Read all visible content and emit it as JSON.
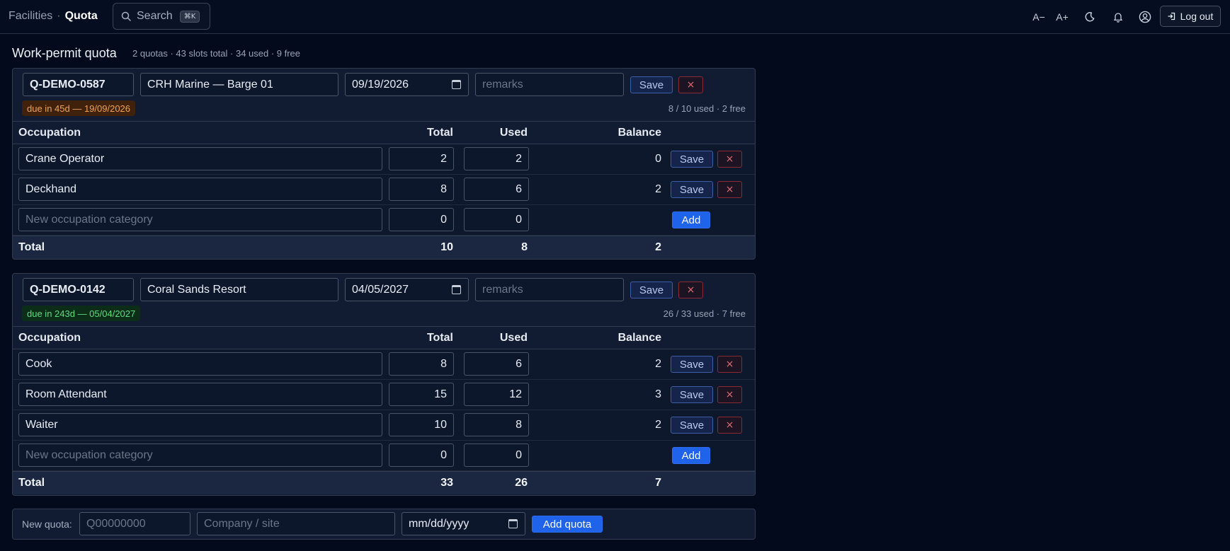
{
  "nav": {
    "breadcrumb_parent": "Facilities",
    "breadcrumb_separator": "·",
    "breadcrumb_current": "Quota",
    "search_label": "Search",
    "search_shortcut": "⌘K",
    "font_decrease": "A−",
    "font_increase": "A+",
    "logout_label": "Log out"
  },
  "page": {
    "title": "Work-permit quota",
    "summary": "2 quotas · 43 slots total · 34 used · 9 free"
  },
  "table_headers": {
    "occupation": "Occupation",
    "total": "Total",
    "used": "Used",
    "balance": "Balance"
  },
  "labels": {
    "save": "Save",
    "delete": "×",
    "add": "Add",
    "total_row": "Total",
    "remarks_placeholder": "remarks",
    "new_occupation_placeholder": "New occupation category"
  },
  "quotas": [
    {
      "code": "Q-DEMO-0587",
      "company": "CRH Marine — Barge 01",
      "date": "09/19/2026",
      "due_label": "due in 45d — 19/09/2026",
      "due_status": "warning",
      "usage": "8 / 10 used · 2 free",
      "rows": [
        {
          "occupation": "Crane Operator",
          "total": "2",
          "used": "2",
          "balance": "0"
        },
        {
          "occupation": "Deckhand",
          "total": "8",
          "used": "6",
          "balance": "2"
        }
      ],
      "new_row": {
        "total": "0",
        "used": "0"
      },
      "totals": {
        "total": "10",
        "used": "8",
        "balance": "2"
      }
    },
    {
      "code": "Q-DEMO-0142",
      "company": "Coral Sands Resort",
      "date": "04/05/2027",
      "due_label": "due in 243d — 05/04/2027",
      "due_status": "ok",
      "usage": "26 / 33 used · 7 free",
      "rows": [
        {
          "occupation": "Cook",
          "total": "8",
          "used": "6",
          "balance": "2"
        },
        {
          "occupation": "Room Attendant",
          "total": "15",
          "used": "12",
          "balance": "3"
        },
        {
          "occupation": "Waiter",
          "total": "10",
          "used": "8",
          "balance": "2"
        }
      ],
      "new_row": {
        "total": "0",
        "used": "0"
      },
      "totals": {
        "total": "33",
        "used": "26",
        "balance": "7"
      }
    }
  ],
  "new_quota": {
    "label": "New quota:",
    "code_placeholder": "Q00000000",
    "company_placeholder": "Company / site",
    "date_placeholder": "mm/dd/yyyy",
    "submit_label": "Add quota"
  },
  "colors": {
    "background": "#030a1c",
    "primary": "#1e63ea",
    "danger": "#e06a72",
    "warning": "#f1a352",
    "success": "#5fdc82"
  }
}
